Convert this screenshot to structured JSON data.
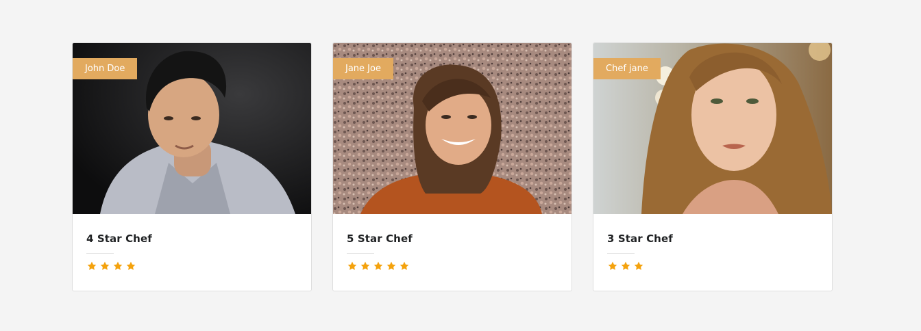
{
  "colors": {
    "page_bg": "#f4f4f4",
    "tag_bg": "#e2aa5f",
    "star": "#f4a20d",
    "title_text": "#1f2123"
  },
  "chefs": [
    {
      "name": "John Doe",
      "rank_label": "4 Star Chef",
      "stars": 4,
      "photo": "chef-portrait-photo"
    },
    {
      "name": "Jane Joe",
      "rank_label": "5 Star Chef",
      "stars": 5,
      "photo": "chef-portrait-photo"
    },
    {
      "name": "Chef jane",
      "rank_label": "3 Star Chef",
      "stars": 3,
      "photo": "chef-portrait-photo"
    }
  ]
}
